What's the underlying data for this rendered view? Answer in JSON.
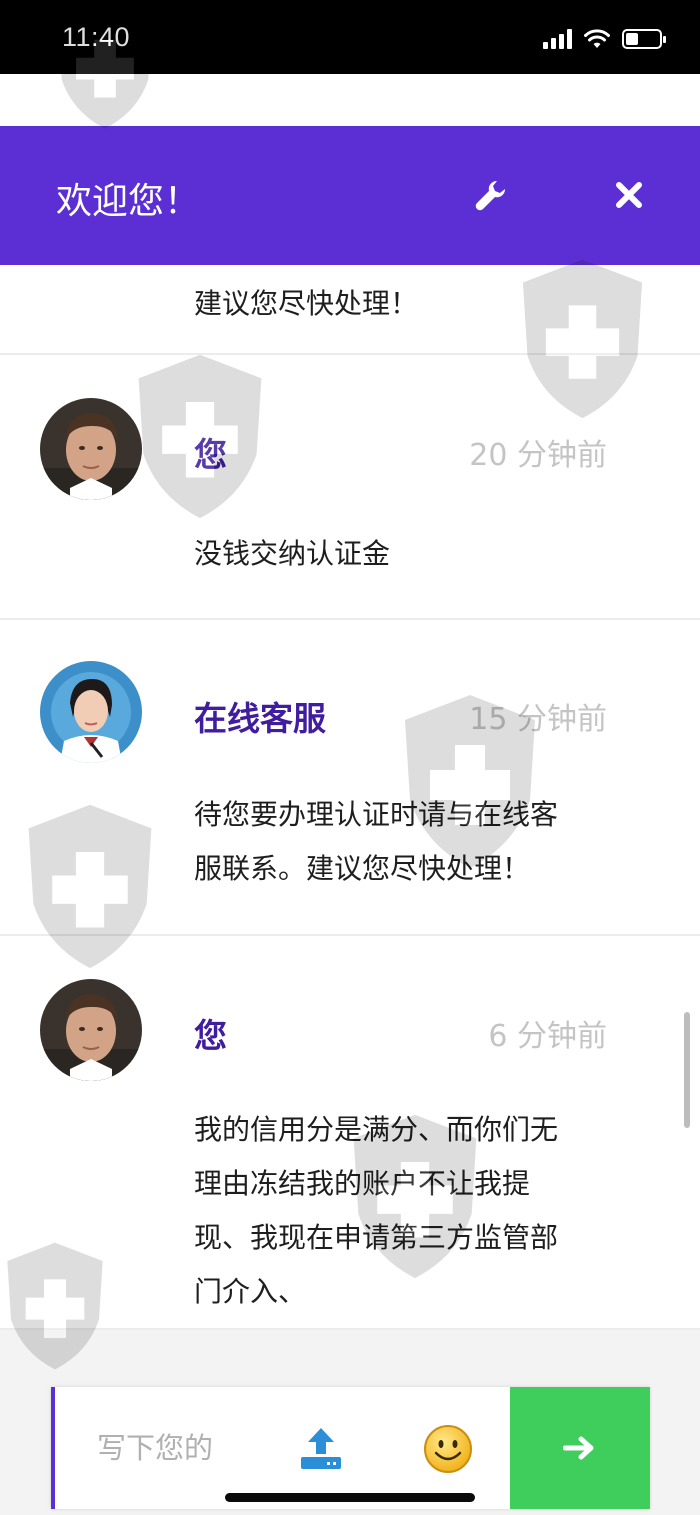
{
  "status_bar": {
    "time": "11:40"
  },
  "header": {
    "title": "欢迎您！",
    "settings_icon": "wrench-icon",
    "close_icon": "close-icon"
  },
  "chat": {
    "partial_message": "建议您尽快处理！",
    "messages": [
      {
        "sender": "您",
        "time": "20 分钟前",
        "lines": [
          "没钱交纳认证金"
        ]
      },
      {
        "sender": "在线客服",
        "time": "15 分钟前",
        "lines": [
          "待您要办理认证时请与在线客",
          "服联系。建议您尽快处理！"
        ]
      },
      {
        "sender": "您",
        "time": "6 分钟前",
        "lines": [
          "我的信用分是满分、而你们无",
          "理由冻结我的账户不让我提",
          "现、我现在申请第三方监管部",
          "门介入、"
        ]
      }
    ]
  },
  "composer": {
    "placeholder": "写下您的",
    "upload_icon": "upload-icon",
    "emoji_icon": "smiley-emoji-icon",
    "send_icon": "arrow-right-icon"
  },
  "colors": {
    "header": "#5b2fd4",
    "sender": "#3f1d9e",
    "send_button": "#3fce5b",
    "timestamp": "#c4c4c4"
  }
}
